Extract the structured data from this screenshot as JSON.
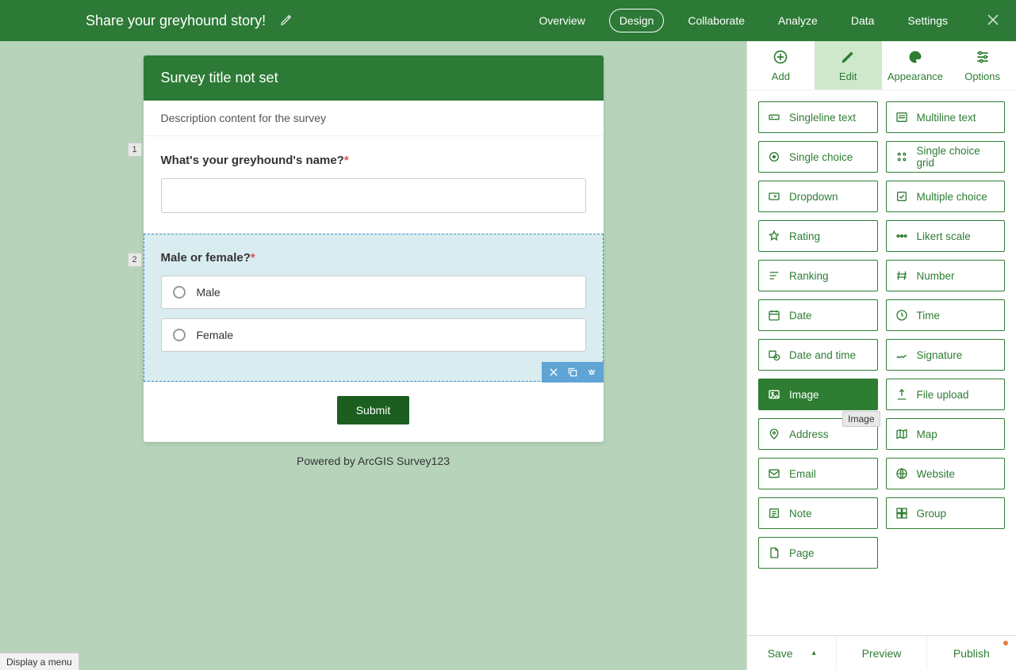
{
  "topbar": {
    "title": "Share your greyhound story!",
    "nav": {
      "overview": "Overview",
      "design": "Design",
      "collaborate": "Collaborate",
      "analyze": "Analyze",
      "data": "Data",
      "settings": "Settings"
    }
  },
  "survey": {
    "title": "Survey title not set",
    "description": "Description content for the survey",
    "questions": [
      {
        "number": "1",
        "label": "What's your greyhound's name?",
        "required": true,
        "type": "text"
      },
      {
        "number": "2",
        "label": "Male or female?",
        "required": true,
        "type": "single_choice",
        "choices": [
          "Male",
          "Female"
        ],
        "selected": true
      }
    ],
    "submit": "Submit",
    "powered_by": "Powered by ArcGIS Survey123"
  },
  "panel": {
    "tabs": {
      "add": "Add",
      "edit": "Edit",
      "appearance": "Appearance",
      "options": "Options"
    },
    "question_types": [
      {
        "label": "Singleline text",
        "icon": "text"
      },
      {
        "label": "Multiline text",
        "icon": "multitext"
      },
      {
        "label": "Single choice",
        "icon": "radio"
      },
      {
        "label": "Single choice grid",
        "icon": "radiogrid"
      },
      {
        "label": "Dropdown",
        "icon": "dropdown"
      },
      {
        "label": "Multiple choice",
        "icon": "checkbox"
      },
      {
        "label": "Rating",
        "icon": "star"
      },
      {
        "label": "Likert scale",
        "icon": "likert"
      },
      {
        "label": "Ranking",
        "icon": "ranking"
      },
      {
        "label": "Number",
        "icon": "number"
      },
      {
        "label": "Date",
        "icon": "date"
      },
      {
        "label": "Time",
        "icon": "time"
      },
      {
        "label": "Date and time",
        "icon": "datetime"
      },
      {
        "label": "Signature",
        "icon": "signature"
      },
      {
        "label": "Image",
        "icon": "image",
        "selected": true,
        "tooltip": "Image"
      },
      {
        "label": "File upload",
        "icon": "upload"
      },
      {
        "label": "Address",
        "icon": "address"
      },
      {
        "label": "Map",
        "icon": "map"
      },
      {
        "label": "Email",
        "icon": "email"
      },
      {
        "label": "Website",
        "icon": "website"
      },
      {
        "label": "Note",
        "icon": "note"
      },
      {
        "label": "Group",
        "icon": "group"
      },
      {
        "label": "Page",
        "icon": "page"
      }
    ]
  },
  "footer": {
    "save": "Save",
    "preview": "Preview",
    "publish": "Publish"
  },
  "statusbar": "Display a menu"
}
